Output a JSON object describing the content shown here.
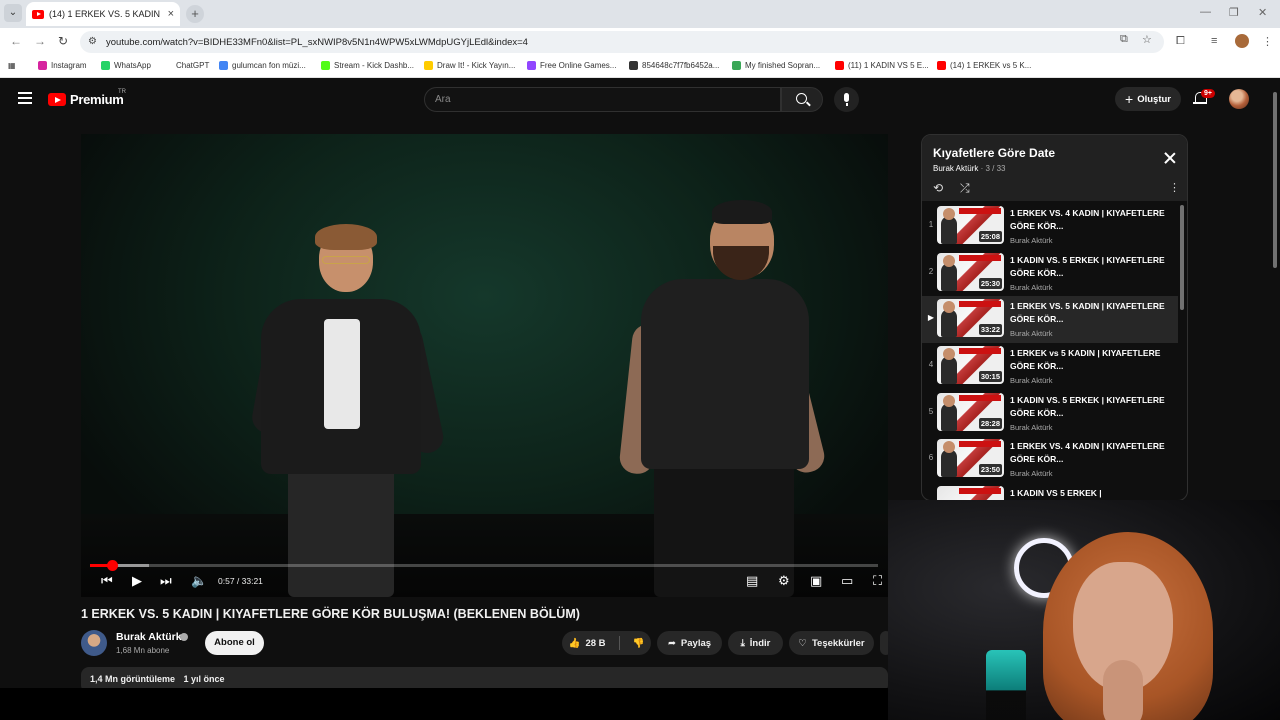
{
  "browser": {
    "tab_title": "(14) 1 ERKEK VS. 5 KADIN | KIYA",
    "url": "youtube.com/watch?v=BIDHE33MFn0&list=PL_sxNWIP8v5N1n4WPW5xLWMdpUGYjLEdl&index=4",
    "bookmarks": [
      {
        "label": "Instagram",
        "color": "#d6249f"
      },
      {
        "label": "WhatsApp",
        "color": "#25d366"
      },
      {
        "label": "ChatGPT",
        "color": "#ffffff"
      },
      {
        "label": "gulumcan fon müzi...",
        "color": "#4285f4"
      },
      {
        "label": "Stream - Kick Dashb...",
        "color": "#53fc18"
      },
      {
        "label": "Draw It! - Kick Yayın...",
        "color": "#ffcc00"
      },
      {
        "label": "Free Online Games...",
        "color": "#9146ff"
      },
      {
        "label": "854648c7f7fb6452a...",
        "color": "#333333"
      },
      {
        "label": "My finished Sopran...",
        "color": "#3aa757"
      },
      {
        "label": "(11) 1 KADIN VS 5 E...",
        "color": "#ff0000"
      },
      {
        "label": "(14) 1 ERKEK vs 5 K...",
        "color": "#ff0000"
      }
    ]
  },
  "header": {
    "logo_text": "Premium",
    "region": "TR",
    "search_placeholder": "Ara",
    "create_label": "Oluştur",
    "notification_count": "9+"
  },
  "player": {
    "current_time": "0:57 / 33:21",
    "played_fraction": 0.028,
    "buffered_fraction": 0.075
  },
  "video": {
    "title": "1 ERKEK VS. 5 KADIN | KIYAFETLERE GÖRE KÖR BULUŞMA! (BEKLENEN BÖLÜM)",
    "channel_name": "Burak Aktürk",
    "subscribers": "1,68 Mn abone",
    "subscribe_label": "Abone ol",
    "likes": "28 B",
    "share_label": "Paylaş",
    "download_label": "İndir",
    "thanks_label": "Teşekkürler",
    "views": "1,4 Mn görüntüleme",
    "published": "1 yıl önce"
  },
  "playlist": {
    "title": "Kıyafetlere Göre Date",
    "owner": "Burak Aktürk",
    "position": "3 / 33",
    "items": [
      {
        "index": "1",
        "title": "1 ERKEK VS. 4 KADIN | KIYAFETLERE GÖRE KÖR...",
        "channel": "Burak Aktürk",
        "duration": "25:08"
      },
      {
        "index": "2",
        "title": "1 KADIN VS. 5 ERKEK | KIYAFETLERE GÖRE KÖR...",
        "channel": "Burak Aktürk",
        "duration": "25:30"
      },
      {
        "index": "▶",
        "title": "1 ERKEK VS. 5 KADIN | KIYAFETLERE GÖRE KÖR...",
        "channel": "Burak Aktürk",
        "duration": "33:22"
      },
      {
        "index": "4",
        "title": "1 ERKEK vs 5 KADIN | KIYAFETLERE GÖRE KÖR...",
        "channel": "Burak Aktürk",
        "duration": "30:15"
      },
      {
        "index": "5",
        "title": "1 KADIN VS. 5 ERKEK | KIYAFETLERE GÖRE KÖR...",
        "channel": "Burak Aktürk",
        "duration": "28:28"
      },
      {
        "index": "6",
        "title": "1 ERKEK VS. 4 KADIN | KIYAFETLERE GÖRE KÖR...",
        "channel": "Burak Aktürk",
        "duration": "23:50"
      },
      {
        "index": "7",
        "title": "1 KADIN VS 5 ERKEK |",
        "channel": "",
        "duration": ""
      }
    ]
  }
}
